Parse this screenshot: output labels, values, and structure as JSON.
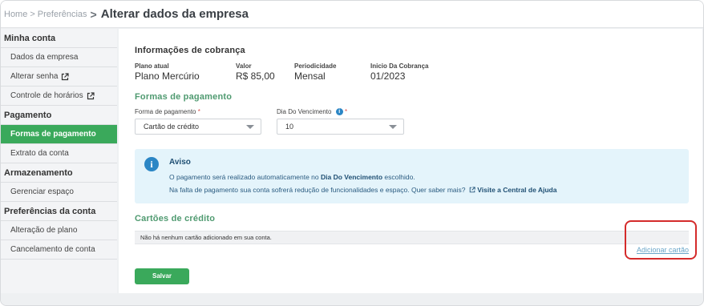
{
  "breadcrumb": {
    "home": "Home",
    "sep": ">",
    "section": "Preferências",
    "chevron": ">",
    "current": "Alterar dados da empresa"
  },
  "sidebar": {
    "groups": [
      {
        "title": "Minha conta",
        "items": [
          {
            "label": "Dados da empresa",
            "external": false
          },
          {
            "label": "Alterar senha",
            "external": true
          },
          {
            "label": "Controle de horários",
            "external": true
          }
        ]
      },
      {
        "title": "Pagamento",
        "items": [
          {
            "label": "Formas de pagamento",
            "active": true
          },
          {
            "label": "Extrato da conta"
          }
        ]
      },
      {
        "title": "Armazenamento",
        "items": [
          {
            "label": "Gerenciar espaço"
          }
        ]
      },
      {
        "title": "Preferências da conta",
        "items": [
          {
            "label": "Alteração de plano"
          },
          {
            "label": "Cancelamento de conta"
          }
        ]
      }
    ]
  },
  "billing": {
    "title": "Informações de cobrança",
    "plan_label": "Plano atual",
    "plan_value": "Plano Mercúrio",
    "price_label": "Valor",
    "price_value": "R$ 85,00",
    "period_label": "Periodicidade",
    "period_value": "Mensal",
    "start_label": "Inicio Da Cobrança",
    "start_value": "01/2023"
  },
  "payment": {
    "title": "Formas de pagamento",
    "method_label": "Forma de pagamento",
    "required_mark": "*",
    "method_value": "Cartão de crédito",
    "due_label": "Dia Do Vencimento",
    "due_value": "10",
    "info_glyph": "i"
  },
  "alert": {
    "title": "Aviso",
    "icon_glyph": "i",
    "line1_pre": "O pagamento será realizado automaticamente no",
    "line1_bold": "Dia Do Vencimento",
    "line1_post": "escolhido.",
    "line2_pre": "Na falta de pagamento sua conta sofrerá redução de funcionalidades e espaço. Quer saber mais?",
    "line2_link": "Visite a Central de Ajuda"
  },
  "cards": {
    "title": "Cartões de crédito",
    "empty": "Não há nenhum cartão adicionado em sua conta.",
    "add": "Adicionar cartão"
  },
  "actions": {
    "save": "Salvar"
  },
  "colors": {
    "accent_green": "#3aa95b",
    "info_blue": "#2b86c5",
    "alert_bg": "#e4f4fb",
    "highlight_red": "#d42b2b"
  },
  "icons": {
    "external_link": "external-link-icon",
    "info": "info-icon",
    "caret": "chevron-down-icon"
  }
}
